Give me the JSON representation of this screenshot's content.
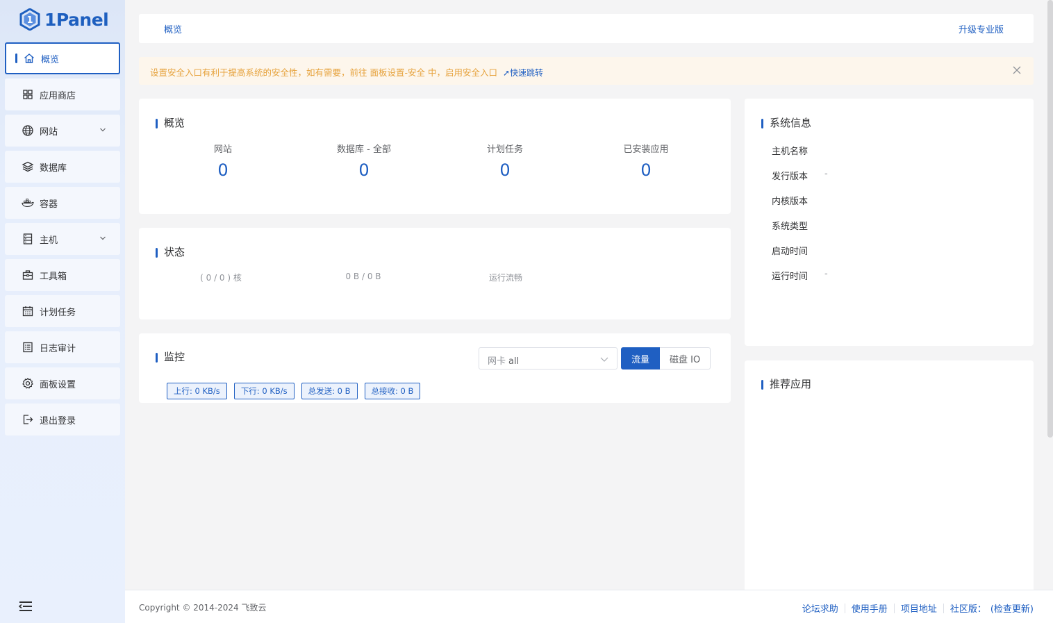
{
  "app": {
    "name": "1Panel"
  },
  "sidebar": {
    "items": [
      {
        "label": "概览",
        "icon": "home-icon",
        "active": true
      },
      {
        "label": "应用商店",
        "icon": "grid-icon"
      },
      {
        "label": "网站",
        "icon": "globe-icon",
        "expandable": true
      },
      {
        "label": "数据库",
        "icon": "layers-icon"
      },
      {
        "label": "容器",
        "icon": "docker-icon"
      },
      {
        "label": "主机",
        "icon": "server-icon",
        "expandable": true
      },
      {
        "label": "工具箱",
        "icon": "toolbox-icon"
      },
      {
        "label": "计划任务",
        "icon": "calendar-icon"
      },
      {
        "label": "日志审计",
        "icon": "log-icon"
      },
      {
        "label": "面板设置",
        "icon": "gear-icon"
      },
      {
        "label": "退出登录",
        "icon": "logout-icon"
      }
    ]
  },
  "header": {
    "breadcrumb": "概览",
    "upgrade": "升级专业版"
  },
  "alert": {
    "text": "设置安全入口有利于提高系统的安全性，如有需要，前往 面板设置-安全 中，启用安全入口",
    "link": "快速跳转",
    "color": "#e6a23c"
  },
  "overview": {
    "title": "概览",
    "stats": [
      {
        "label": "网站",
        "value": "0"
      },
      {
        "label": "数据库 - 全部",
        "value": "0"
      },
      {
        "label": "计划任务",
        "value": "0"
      },
      {
        "label": "已安装应用",
        "value": "0"
      }
    ]
  },
  "status": {
    "title": "状态",
    "items": [
      "( 0 / 0 ) 核",
      "0 B / 0 B",
      "运行流畅"
    ]
  },
  "monitor": {
    "title": "监控",
    "nic_label": "网卡",
    "nic_value": "all",
    "tab_traffic": "流量",
    "tab_disk": "磁盘 IO",
    "tags": [
      "上行: 0 KB/s",
      "下行: 0 KB/s",
      "总发送: 0 B",
      "总接收: 0 B"
    ]
  },
  "sysinfo": {
    "title": "系统信息",
    "rows": [
      {
        "label": "主机名称",
        "value": ""
      },
      {
        "label": "发行版本",
        "value": "-"
      },
      {
        "label": "内核版本",
        "value": ""
      },
      {
        "label": "系统类型",
        "value": ""
      },
      {
        "label": "启动时间",
        "value": ""
      },
      {
        "label": "运行时间",
        "value": "-"
      }
    ]
  },
  "recommend": {
    "title": "推荐应用"
  },
  "footer": {
    "copyright": "Copyright © 2014-2024 飞致云",
    "links": [
      "论坛求助",
      "使用手册",
      "项目地址",
      "社区版：",
      "(检查更新)"
    ]
  },
  "colors": {
    "primary": "#1f5fc2",
    "warning": "#e6a23c"
  }
}
